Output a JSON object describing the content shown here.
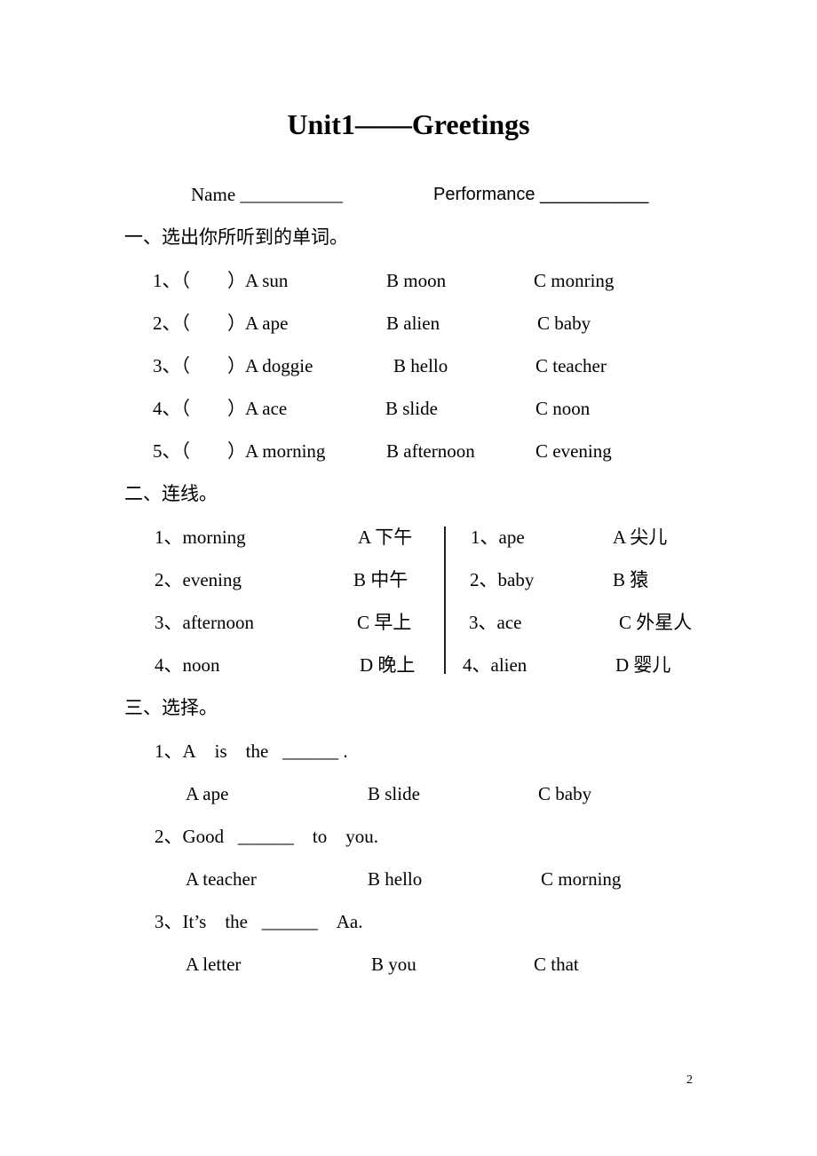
{
  "title": "Unit1——Greetings",
  "header": {
    "name_label": "Name ___________",
    "performance_label": "Performance ___________"
  },
  "section1": {
    "heading": "一、选出你所听到的单词。",
    "items": [
      {
        "num": "1、（　　）",
        "a": "A sun",
        "b": "B moon",
        "c": "C monring"
      },
      {
        "num": "2、（　　）",
        "a": "A ape",
        "b": "B alien",
        "c": "C baby"
      },
      {
        "num": "3、（　　）",
        "a": "A doggie",
        "b": "B hello",
        "c": "C teacher"
      },
      {
        "num": "4、（　　）",
        "a": "A ace",
        "b": "B slide",
        "c": "C noon"
      },
      {
        "num": "5、（　　）",
        "a": "A morning",
        "b": "B afternoon",
        "c": "C evening"
      }
    ]
  },
  "section2": {
    "heading": "二、连线。",
    "left": [
      {
        "word": "1、morning",
        "meaning": "A 下午"
      },
      {
        "word": "2、evening",
        "meaning": "B  中午"
      },
      {
        "word": "3、afternoon",
        "meaning": "C 早上"
      },
      {
        "word": "4、noon",
        "meaning": "D 晚上"
      }
    ],
    "right": [
      {
        "word": "1、ape",
        "meaning": "A 尖儿"
      },
      {
        "word": "2、baby",
        "meaning": "B  猿"
      },
      {
        "word": "3、ace",
        "meaning": "C 外星人"
      },
      {
        "word": "4、alien",
        "meaning": "D 婴儿"
      }
    ]
  },
  "section3": {
    "heading": "三、选择。",
    "items": [
      {
        "question": "1、A    is    the   ______ .",
        "a": "A ape",
        "b": "B slide",
        "c": "C baby"
      },
      {
        "question": "2、Good   ______    to    you.",
        "a": "A teacher",
        "b": "B hello",
        "c": "C morning"
      },
      {
        "question": "3、It’s    the   ______    Aa.",
        "a": "A letter",
        "b": "B you",
        "c": "C that"
      }
    ]
  },
  "page_number": "2"
}
